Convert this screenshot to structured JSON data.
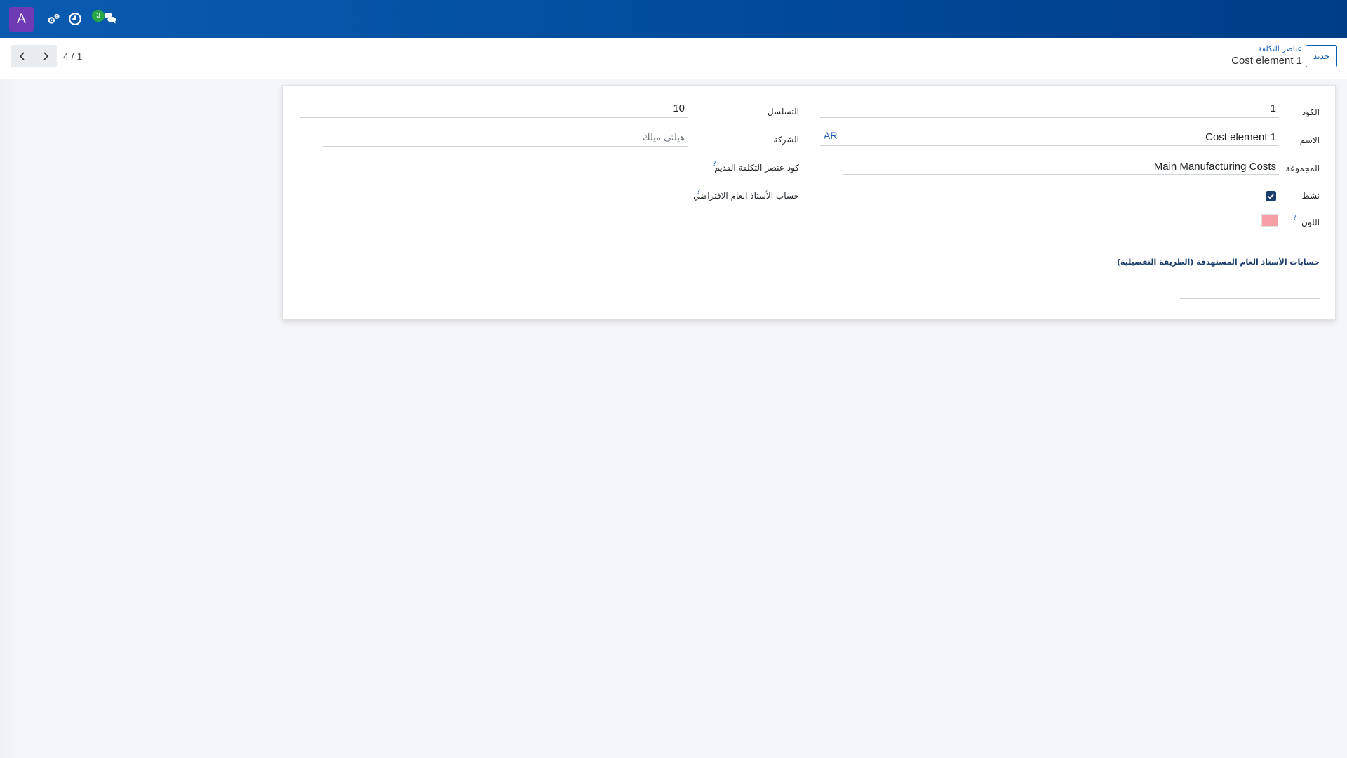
{
  "navbar": {
    "avatar_letter": "A",
    "icons": [
      "settings-cogs-icon",
      "clock-icon",
      "chat-icon"
    ],
    "chat_badge": "3",
    "colors": {
      "bar": "#0a5bb0",
      "avatar": "#6f3bb5",
      "badge": "#28a745"
    }
  },
  "control_panel": {
    "pager": {
      "value": "4 / 1"
    },
    "new_button": "جديد",
    "breadcrumb": {
      "parent": "عناصر التكلفة",
      "current": "Cost element 1"
    }
  },
  "form": {
    "code": {
      "label": "الكود",
      "value": "1"
    },
    "name": {
      "label": "الاسم",
      "value": "Cost element 1",
      "lang": "AR"
    },
    "group": {
      "label": "المجموعة",
      "value": "Main Manufacturing Costs"
    },
    "active": {
      "label": "نشط",
      "checked": true
    },
    "color": {
      "label": "اللون",
      "help": "?",
      "value": "#f4a0a6"
    },
    "sequence": {
      "label": "التسلسل",
      "value": "10"
    },
    "company": {
      "label": "الشركة",
      "value": "هيلتي ميلك"
    },
    "old_code": {
      "label": "كود عنصر التكلفة القديم",
      "help": "?",
      "value": ""
    },
    "default_account": {
      "label": "حساب الأستاذ العام الافتراضي",
      "help": "?",
      "value": ""
    },
    "targeted_accounts": {
      "title": "حسابات الأستاذ العام المستهدفة (الطريقة التفصيلية)"
    }
  }
}
